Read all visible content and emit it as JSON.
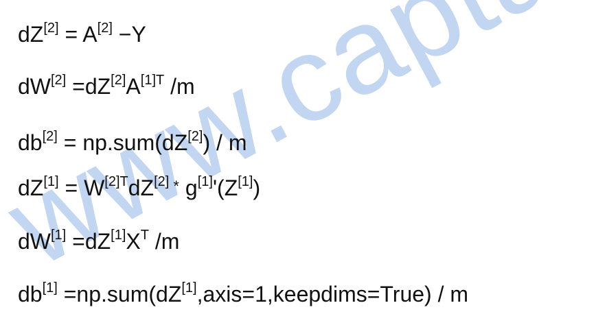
{
  "watermark": "www.captainbe",
  "equations": [
    {
      "lhs": "dZ",
      "lhs_sup": "[2]",
      "eq": " = ",
      "a": "A",
      "a_sup": "[2]",
      "b": " −Y"
    },
    {
      "lhs": "dW",
      "lhs_sup": "[2]",
      "eq": " =",
      "a": "dZ",
      "a_sup": "[2]",
      "b": "A",
      "b_sup": "[1]T",
      "c": " /m"
    },
    {
      "lhs": "db",
      "lhs_sup": "[2]",
      "eq": " = ",
      "a": "np.sum(dZ",
      "a_sup": "[2]",
      "b": ") / m"
    },
    {
      "lhs": "dZ",
      "lhs_sup": "[1]",
      "eq": " = ",
      "a": "W",
      "a_sup": "[2]T",
      "b": "dZ",
      "b_sup": "[2]",
      "star": " *",
      "c": " g",
      "c_sup": "[1]",
      "d": "'(Z",
      "d_sup": "[1]",
      "e": ")"
    },
    {
      "lhs": "dW",
      "lhs_sup": "[1]",
      "eq": "  =",
      "a": "dZ",
      "a_sup": "[1]",
      "b": "X",
      "b_sup": "T",
      "c": " /m"
    },
    {
      "lhs": "db",
      "lhs_sup": "[1]",
      "eq": " =",
      "a": "np.sum(dZ",
      "a_sup": "[1]",
      "b": ",axis=1,keepdims=True) / m"
    }
  ]
}
